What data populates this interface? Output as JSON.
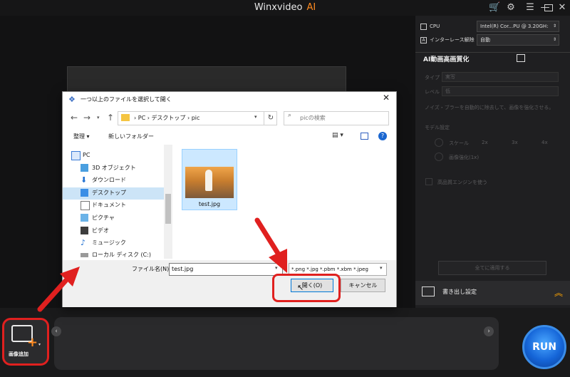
{
  "app": {
    "title": "Winxvideo",
    "title_ai": "AI",
    "icons": [
      "cart-icon",
      "settings-icon",
      "menu-icon",
      "minimize-icon",
      "maximize-icon",
      "close-icon"
    ]
  },
  "right_panel": {
    "cpu_label": "CPU",
    "cpu_value": "Intel(R) Cor...PU @ 3.20GH:",
    "deinterlace_label": "インターレース解除",
    "deinterlace_value": "自動",
    "ai_title": "AI動画高画質化",
    "type_label": "タイプ",
    "type_value": "実写",
    "level_label": "レベル",
    "level_value": "低",
    "description": "ノイズ・ブラーを自動的に除去して、画像を強化させる。",
    "model_label": "モデル設定",
    "scale_label": "スケール",
    "scale_options": [
      "2x",
      "3x",
      "4x"
    ],
    "enhance_label": "画像強化(1x)",
    "hq_label": "高品質エンジンを使う",
    "apply_all": "全てに適用する",
    "export_label": "書き出し設定"
  },
  "bottom": {
    "add_label": "画像追加",
    "run_label": "RUN"
  },
  "dialog": {
    "title": "一つ以上のファイルを選択して開く",
    "breadcrumb": "›  PC  ›  デスクトップ  ›  pic",
    "search_placeholder": "picの検索",
    "organize": "整理 ▾",
    "new_folder": "新しいフォルダー",
    "nav_items": [
      {
        "label": "PC"
      },
      {
        "label": "3D オブジェクト"
      },
      {
        "label": "ダウンロード"
      },
      {
        "label": "デスクトップ"
      },
      {
        "label": "ドキュメント"
      },
      {
        "label": "ピクチャ"
      },
      {
        "label": "ビデオ"
      },
      {
        "label": "ミュージック"
      },
      {
        "label": "ローカル ディスク (C:)"
      }
    ],
    "file_name_display": "test.jpg",
    "filename_label": "ファイル名(N):",
    "filename_value": "test.jpg",
    "filter_value": "*.png *.jpg *.pbm *.xbm *.jpeg",
    "open_label": "開く(O)",
    "cancel_label": "キャンセル"
  },
  "colors": {
    "accent_orange": "#ff8a1f",
    "highlight_red": "#e0201f",
    "run_blue": "#1565d8",
    "selection_blue": "#cce4f7"
  }
}
